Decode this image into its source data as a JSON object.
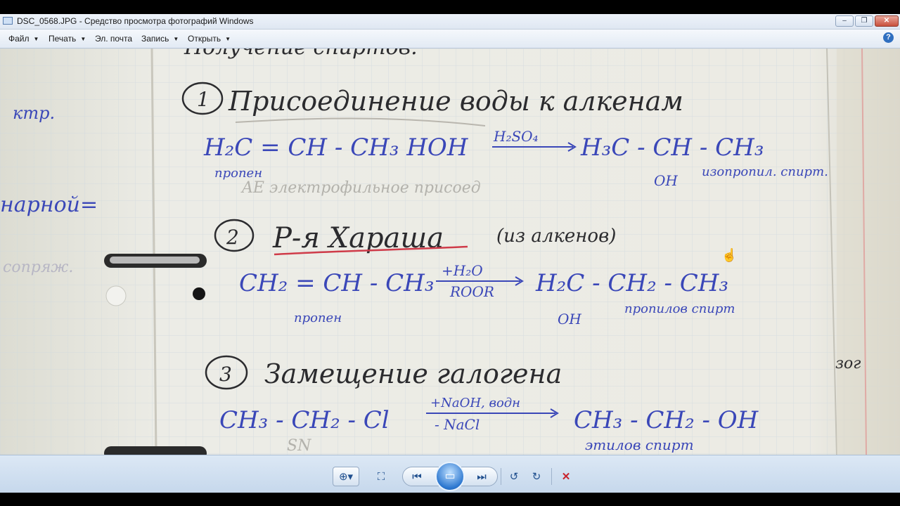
{
  "window": {
    "title": "DSC_0568.JPG - Средство просмотра фотографий Windows",
    "minimize_glyph": "–",
    "maximize_glyph": "❐",
    "close_glyph": "✕"
  },
  "menu": {
    "items": [
      {
        "label": "Файл",
        "has_arrow": true
      },
      {
        "label": "Печать",
        "has_arrow": true
      },
      {
        "label": "Эл. почта",
        "has_arrow": false
      },
      {
        "label": "Запись",
        "has_arrow": true
      },
      {
        "label": "Открыть",
        "has_arrow": true
      }
    ],
    "help_glyph": "?"
  },
  "photo": {
    "heading_partial": "Получение спиртов.",
    "item1_num": "1",
    "item1_title": "Присоединение воды к алкенам",
    "eq1_left": "H₂C = CH - CH₃ HOH",
    "eq1_cond": "H₂SO₄",
    "eq1_right": "H₃C - CH - CH₃",
    "eq1_oh": "OH",
    "eq1_left_name": "пропен",
    "eq1_right_name": "изопропил. спирт.",
    "eq1_note": "AE электрофильное присоед",
    "item2_num": "2",
    "item2_title": "Р-я Хараша",
    "item2_note": "(из алкенов)",
    "eq2_left": "CH₂ = CH - CH₃",
    "eq2_cond_top": "+H₂O",
    "eq2_cond_bottom": "ROOR",
    "eq2_right": "H₂C - CH₂ - CH₃",
    "eq2_oh": "OH",
    "eq2_left_name": "пропен",
    "eq2_right_name": "пропилов спирт",
    "item3_num": "3",
    "item3_title": "Замещение галогена",
    "eq3_left": "CH₃ - CH₂ - Cl",
    "eq3_cond_top": "+NaOH, водн",
    "eq3_cond_bottom": "- NaCl",
    "eq3_right": "CH₃ - CH₂ - OH",
    "eq3_right_name": "этилов спирт",
    "eq3_note": "SN",
    "left_page_words": [
      "ктр.",
      "нарной=",
      "сопряж."
    ],
    "right_edge_word": "зог"
  },
  "controls": {
    "zoom_glyph": "⊕▾",
    "fit_glyph": "⛶",
    "prev_glyph": "⏮",
    "slideshow_glyph": "▭",
    "next_glyph": "⏭",
    "rotate_left_glyph": "↺",
    "rotate_right_glyph": "↻",
    "delete_glyph": "✕"
  },
  "colors": {
    "ink_blue": "#3a47b8",
    "ink_dark": "#2b2b2e",
    "ink_red": "#cf3b49",
    "paper": "#ececE6",
    "margin_red": "#e07a80",
    "grid": "#c9d4dc"
  }
}
